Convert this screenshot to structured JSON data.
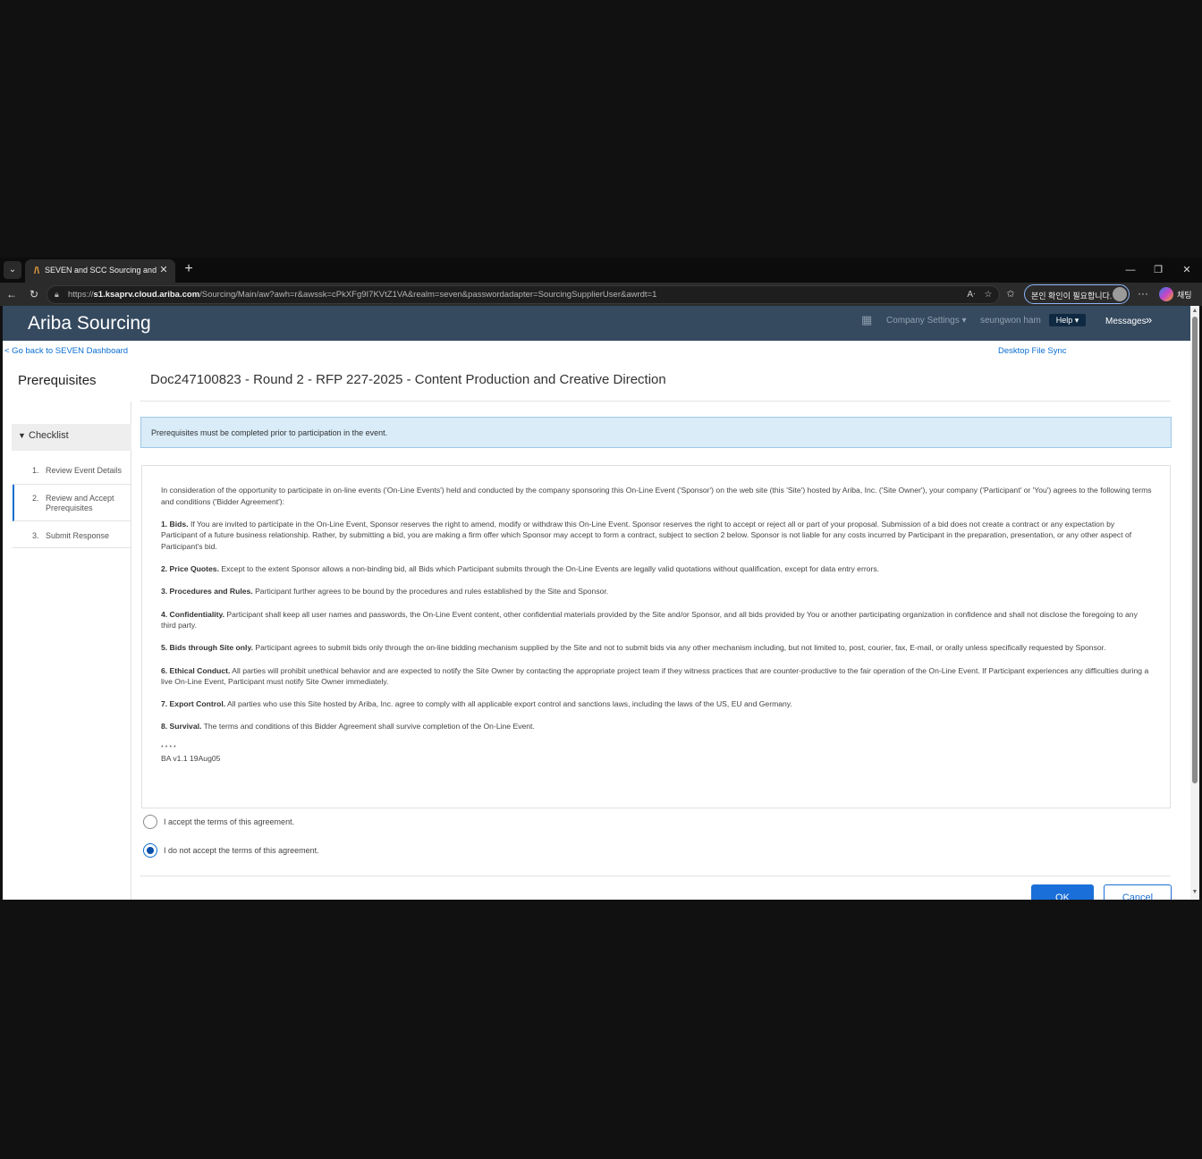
{
  "browser": {
    "tab_title": "SEVEN and SCC Sourcing and Vendor",
    "url_prefix": "https://",
    "url_host": "s1.ksaprv.cloud.ariba.com",
    "url_path": "/Sourcing/Main/aw?awh=r&awssk=cPkXFg9I7KVtZ1VA&realm=seven&passwordadapter=SourcingSupplierUser&awrdt=1",
    "identity_label": "본인 확인이 필요합니다.",
    "copilot_label": "채팅"
  },
  "header": {
    "brand": "Ariba Sourcing",
    "company_settings": "Company Settings ▾",
    "user_name": "seungwon ham",
    "help": "Help ▾",
    "messages": "Messages"
  },
  "links": {
    "back": "< Go back to SEVEN Dashboard",
    "desktop_sync": "Desktop File Sync"
  },
  "page": {
    "title": "Prerequisites",
    "doc_title": "Doc247100823 - Round 2 - RFP 227-2025 - Content Production and Creative Direction"
  },
  "checklist": {
    "label": "Checklist",
    "steps": [
      {
        "num": "1.",
        "label": "Review Event Details"
      },
      {
        "num": "2.",
        "label": "Review and Accept Prerequisites"
      },
      {
        "num": "3.",
        "label": "Submit Response"
      }
    ]
  },
  "banner": "Prerequisites must be completed prior to participation in the event.",
  "terms": {
    "intro": "In consideration of the opportunity to participate in on-line events ('On-Line Events') held and conducted by the company sponsoring this On-Line Event ('Sponsor') on the web site (this 'Site') hosted by Ariba, Inc. ('Site Owner'), your company ('Participant' or 'You') agrees to the following terms and conditions ('Bidder Agreement'):",
    "sections": [
      {
        "head": "1. Bids.",
        "body": " If You are invited to participate in the On-Line Event, Sponsor reserves the right to amend, modify or withdraw this On-Line Event. Sponsor reserves the right to accept or reject all or part of your proposal. Submission of a bid does not create a contract or any expectation by Participant of a future business relationship. Rather, by submitting a bid, you are making a firm offer which Sponsor may accept to form a contract, subject to section 2 below. Sponsor is not liable for any costs incurred by Participant in the preparation, presentation, or any other aspect of Participant's bid."
      },
      {
        "head": "2. Price Quotes.",
        "body": " Except to the extent Sponsor allows a non-binding bid, all Bids which Participant submits through the On-Line Events are legally valid quotations without qualification, except for data entry errors."
      },
      {
        "head": "3. Procedures and Rules.",
        "body": " Participant further agrees to be bound by the procedures and rules established by the Site and Sponsor."
      },
      {
        "head": "4. Confidentiality.",
        "body": " Participant shall keep all user names and passwords, the On-Line Event content, other confidential materials provided by the Site and/or Sponsor, and all bids provided by You or another participating organization in confidence and shall not disclose the foregoing to any third party."
      },
      {
        "head": "5. Bids through Site only.",
        "body": " Participant agrees to submit bids only through the on-line bidding mechanism supplied by the Site and not to submit bids via any other mechanism including, but not limited to, post, courier, fax, E-mail, or orally unless specifically requested by Sponsor."
      },
      {
        "head": "6. Ethical Conduct.",
        "body": " All parties will prohibit unethical behavior and are expected to notify the Site Owner by contacting the appropriate project team if they witness practices that are counter-productive to the fair operation of the On-Line Event. If Participant experiences any difficulties during a live On-Line Event, Participant must notify Site Owner immediately."
      },
      {
        "head": "7. Export Control.",
        "body": " All parties who use this Site hosted by Ariba, Inc. agree to comply with all applicable export control and sanctions laws, including the laws of the US, EU and Germany."
      },
      {
        "head": "8. Survival.",
        "body": " The terms and conditions of this Bidder Agreement shall survive completion of the On-Line Event."
      }
    ],
    "stars": "* * * *",
    "version": "BA v1.1 19Aug05"
  },
  "options": {
    "accept": "I accept the terms of this agreement.",
    "decline": "I do not accept the terms of this agreement.",
    "selected": "decline"
  },
  "buttons": {
    "ok": "OK",
    "cancel": "Cancel"
  },
  "colors": {
    "header_bg": "#354a5f",
    "link": "#0a6ed1",
    "primary_button": "#1a6fd8",
    "banner_bg": "#d9ecf8"
  }
}
